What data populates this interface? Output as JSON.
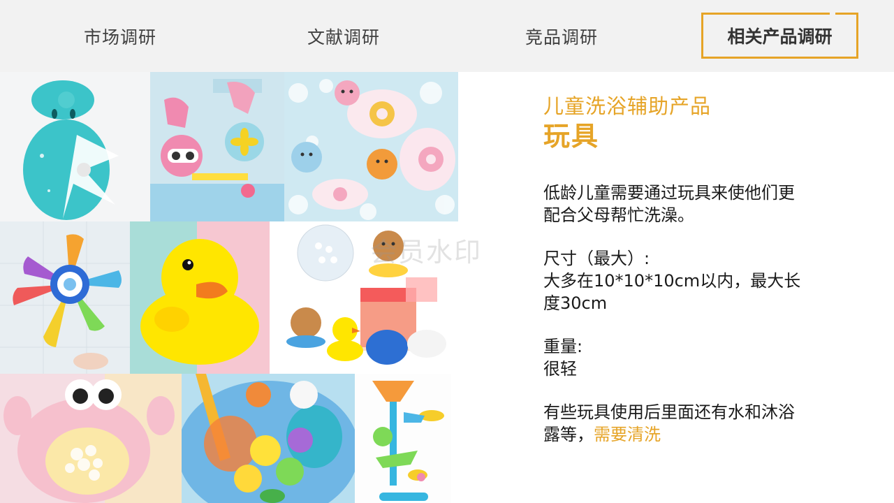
{
  "tabs": [
    {
      "label": "市场调研"
    },
    {
      "label": "文献调研"
    },
    {
      "label": "竞品调研"
    },
    {
      "label": "相关产品调研",
      "active": true
    }
  ],
  "accent_color": "#e6a427",
  "content": {
    "subtitle": "儿童洗浴辅助产品",
    "title": "玩具",
    "para1_line1": "低龄儿童需要通过玩具来使他们更",
    "para1_line2": "配合父母帮忙洗澡。",
    "para2_line1": "尺寸（最大）:",
    "para2_line2": "大多在10*10*10cm以内，最大长",
    "para2_line3": "度30cm",
    "para3_line1": "重量:",
    "para3_line2": "很轻",
    "para4_line1": "有些玩具使用后里面还有水和沐浴",
    "para4_line2_prefix": "露等，",
    "para4_line2_highlight": "需要清洗"
  },
  "watermark": "会员水印",
  "photos": [
    {
      "icon": "whale-waterwheel-toy"
    },
    {
      "icon": "water-pipe-toy"
    },
    {
      "icon": "floating-animal-boats"
    },
    {
      "icon": "windmill-toy"
    },
    {
      "icon": "rubber-duck"
    },
    {
      "icon": "bear-bucket-set"
    },
    {
      "icon": "crab-bubble-machine"
    },
    {
      "icon": "fishing-net-toys"
    },
    {
      "icon": "water-tower-toy"
    }
  ]
}
